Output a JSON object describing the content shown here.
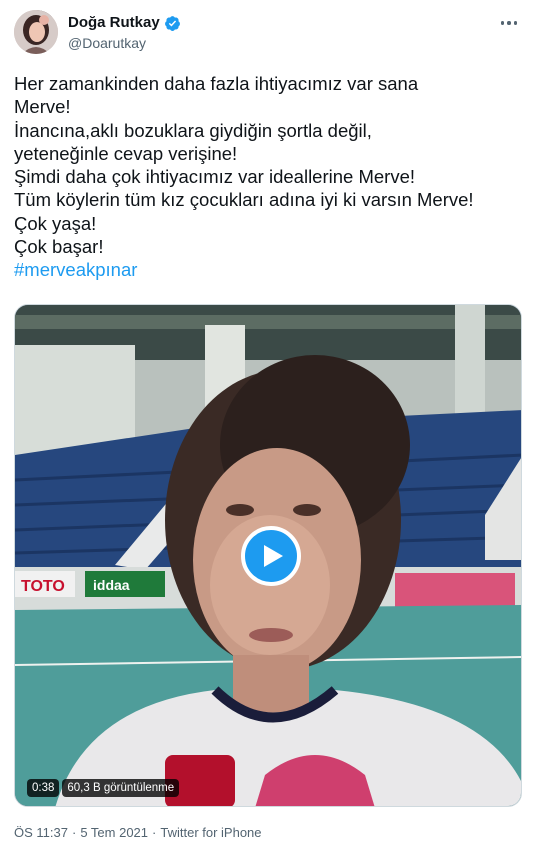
{
  "tweet": {
    "author": {
      "display_name": "Doğa Rutkay",
      "handle": "@Doarutkay",
      "verified": true,
      "avatar_icon": "avatar-photo"
    },
    "more_icon": "more-options-icon",
    "text_lines": [
      "Her zamankinden daha fazla ihtiyacımız var sana",
      "Merve!",
      "İnancına,aklı bozuklara giydiğin şortla  değil,",
      "yeteneğinle cevap verişine!",
      "Şimdi daha çok ihtiyacımız var ideallerine Merve!",
      "Tüm köylerin tüm kız çocukları adına iyi ki varsın Merve!",
      "Çok yaşa!",
      "Çok başar!"
    ],
    "hashtag": "#merveakpınar",
    "media": {
      "type": "video",
      "duration": "0:38",
      "views": "60,3 B görüntülenme",
      "play_icon": "play-icon",
      "court_banners": [
        "TOTO",
        "iddaa"
      ]
    },
    "time": "ÖS 11:37",
    "date": "5 Tem 2021",
    "source": "Twitter for iPhone",
    "separator": "·"
  },
  "colors": {
    "accent": "#1d9bf0",
    "text": "#0f1419",
    "secondary": "#536471"
  }
}
